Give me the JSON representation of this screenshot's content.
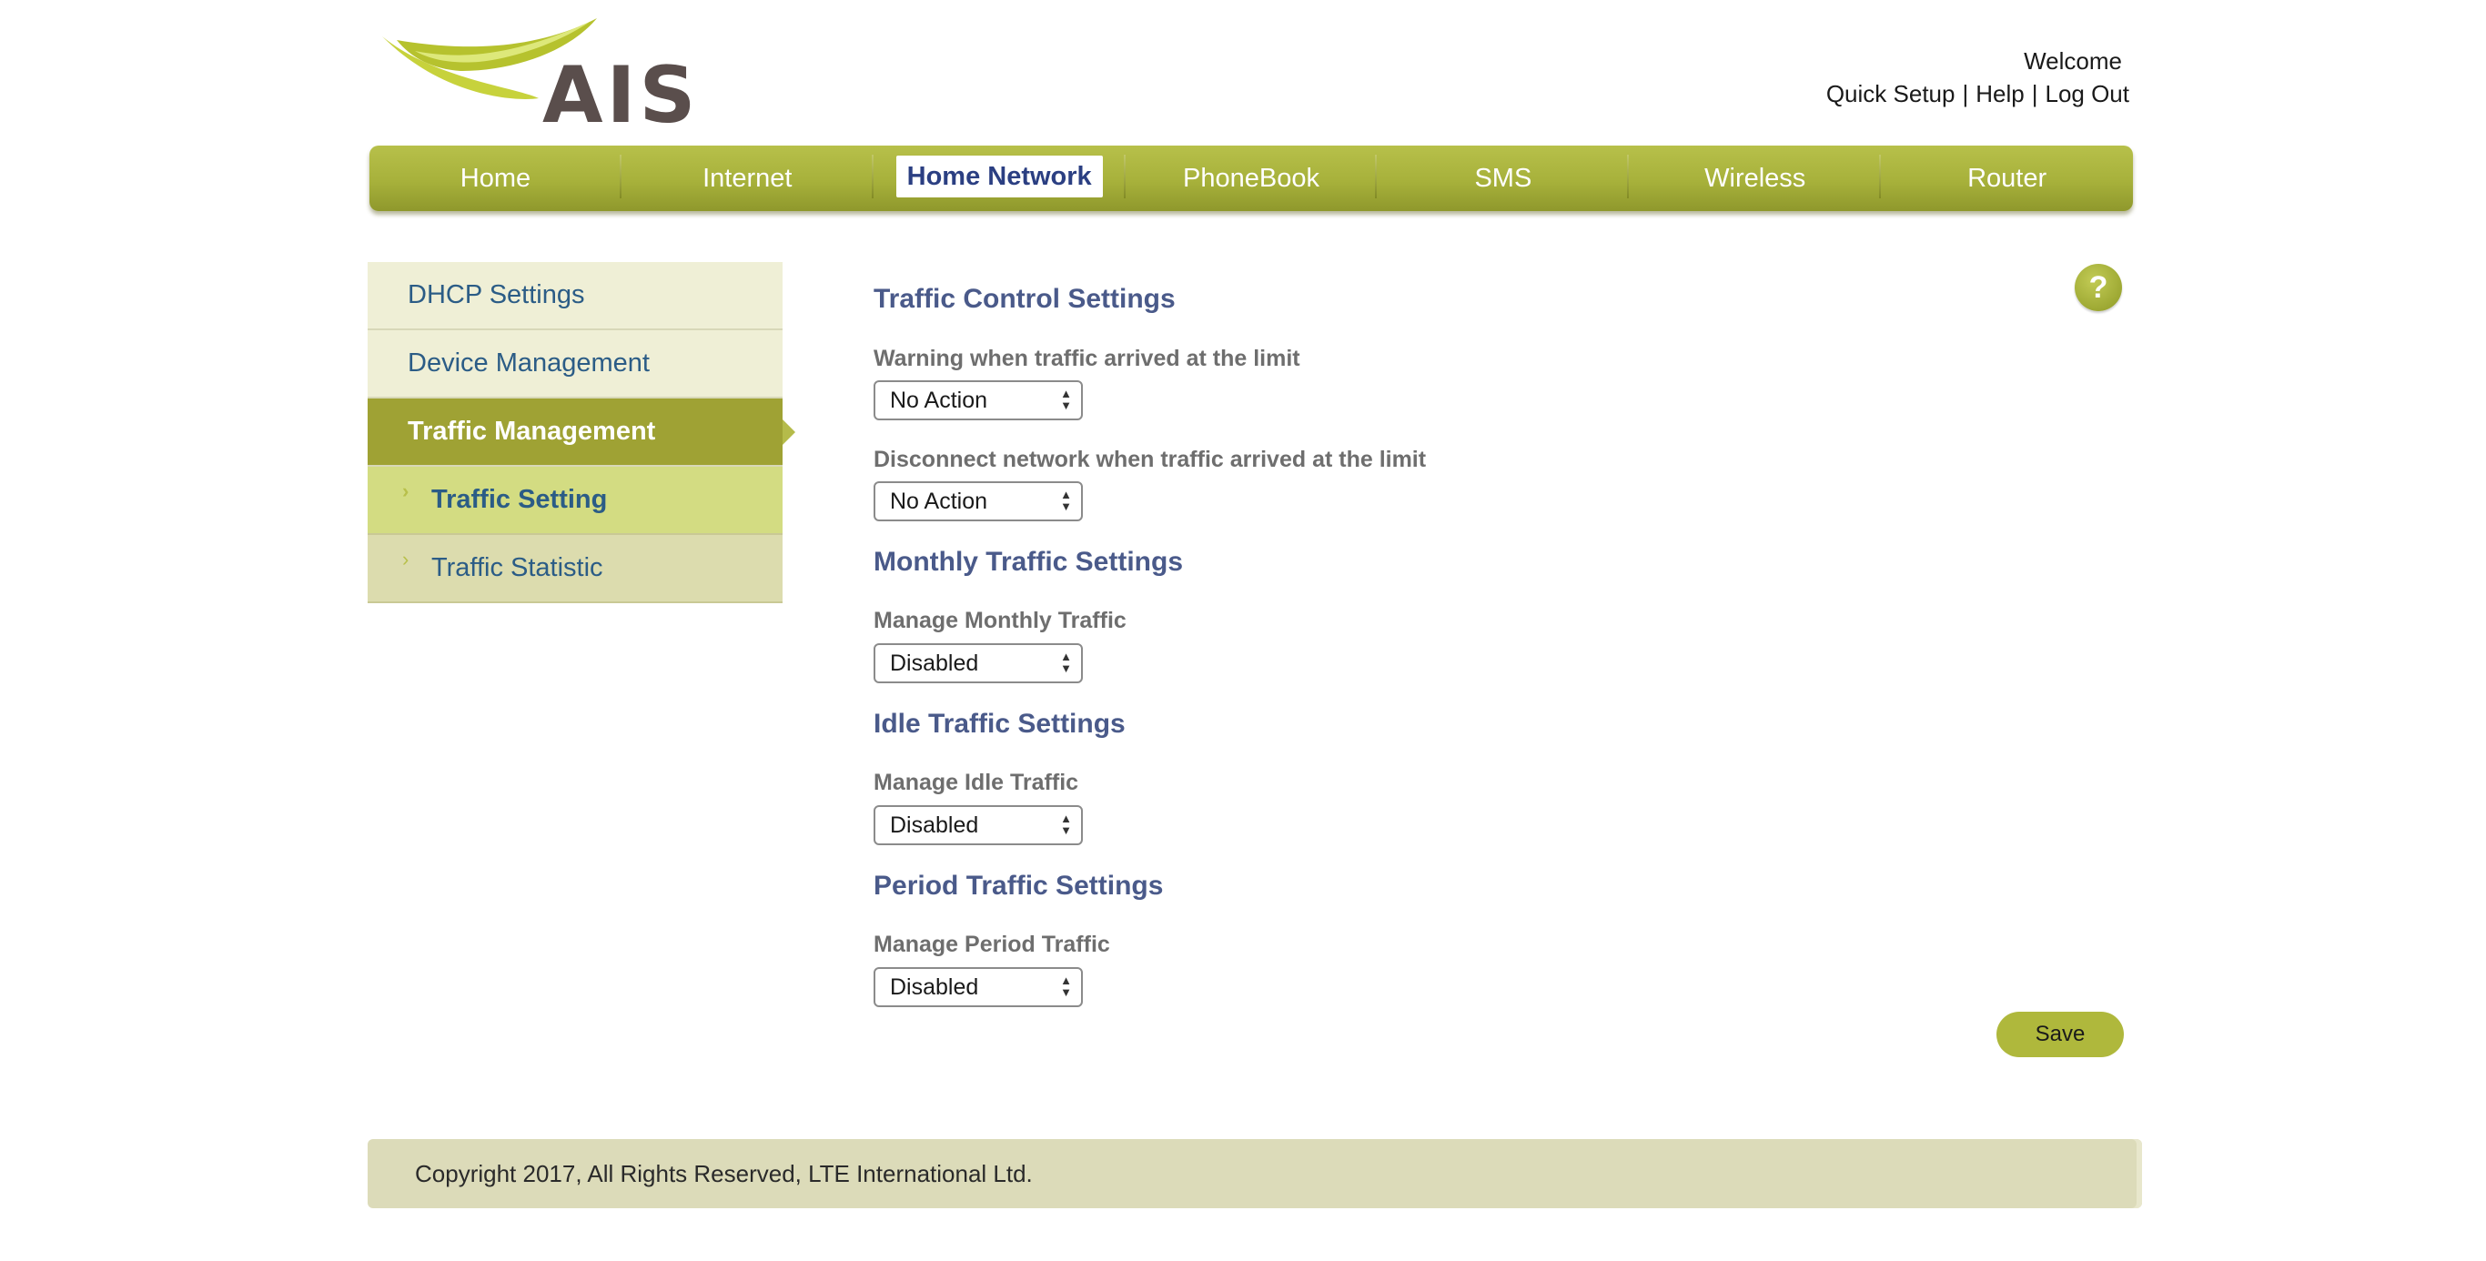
{
  "header": {
    "logo_text": "AIS",
    "welcome": "Welcome",
    "links": [
      "Quick Setup",
      "Help",
      "Log Out"
    ],
    "separator": "|"
  },
  "nav": {
    "items": [
      "Home",
      "Internet",
      "Home Network",
      "PhoneBook",
      "SMS",
      "Wireless",
      "Router"
    ],
    "active": "Home Network"
  },
  "sidebar": {
    "items": [
      "DHCP Settings",
      "Device Management",
      "Traffic Management"
    ],
    "active": "Traffic Management",
    "subitems": [
      "Traffic Setting",
      "Traffic Statistic"
    ],
    "current_sub": "Traffic Setting"
  },
  "main": {
    "help_icon": "?",
    "sections": {
      "traffic_control": {
        "title": "Traffic Control Settings",
        "warning_label": "Warning when traffic arrived at the limit",
        "warning_value": "No Action",
        "disconnect_label": "Disconnect network when traffic arrived at the limit",
        "disconnect_value": "No Action"
      },
      "monthly": {
        "title": "Monthly Traffic Settings",
        "label": "Manage Monthly Traffic",
        "value": "Disabled"
      },
      "idle": {
        "title": "Idle Traffic Settings",
        "label": "Manage Idle Traffic",
        "value": "Disabled"
      },
      "period": {
        "title": "Period Traffic Settings",
        "label": "Manage Period Traffic",
        "value": "Disabled"
      }
    },
    "save_label": "Save"
  },
  "footer": {
    "copyright": "Copyright 2017, All Rights Reserved, LTE International Ltd."
  },
  "colors": {
    "nav_green": "#a7b13b",
    "sidebar_active": "#9fa234",
    "section_title": "#4a5a8a",
    "link_blue": "#2b5c86"
  }
}
